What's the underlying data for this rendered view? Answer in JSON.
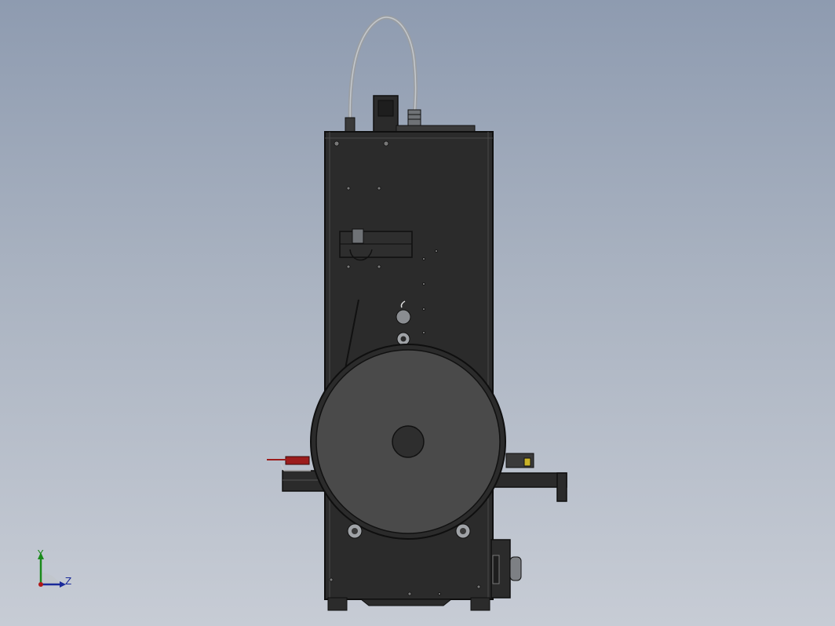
{
  "viewport": {
    "background_top": "#8e9bb0",
    "background_bottom": "#c7ccd5"
  },
  "model": {
    "body_color": "#2b2b2b",
    "edge_color": "#0f0f0f",
    "reel_color": "#4a4a4a",
    "cable_color": "#9a9ea3",
    "accent_red": "#9c1c1c",
    "accent_yellow": "#c9b227"
  },
  "triad": {
    "y_label": "Y",
    "z_label": "Z",
    "y_color": "#1a8a1a",
    "z_color": "#1a2a9a",
    "x_color": "#b01818"
  }
}
